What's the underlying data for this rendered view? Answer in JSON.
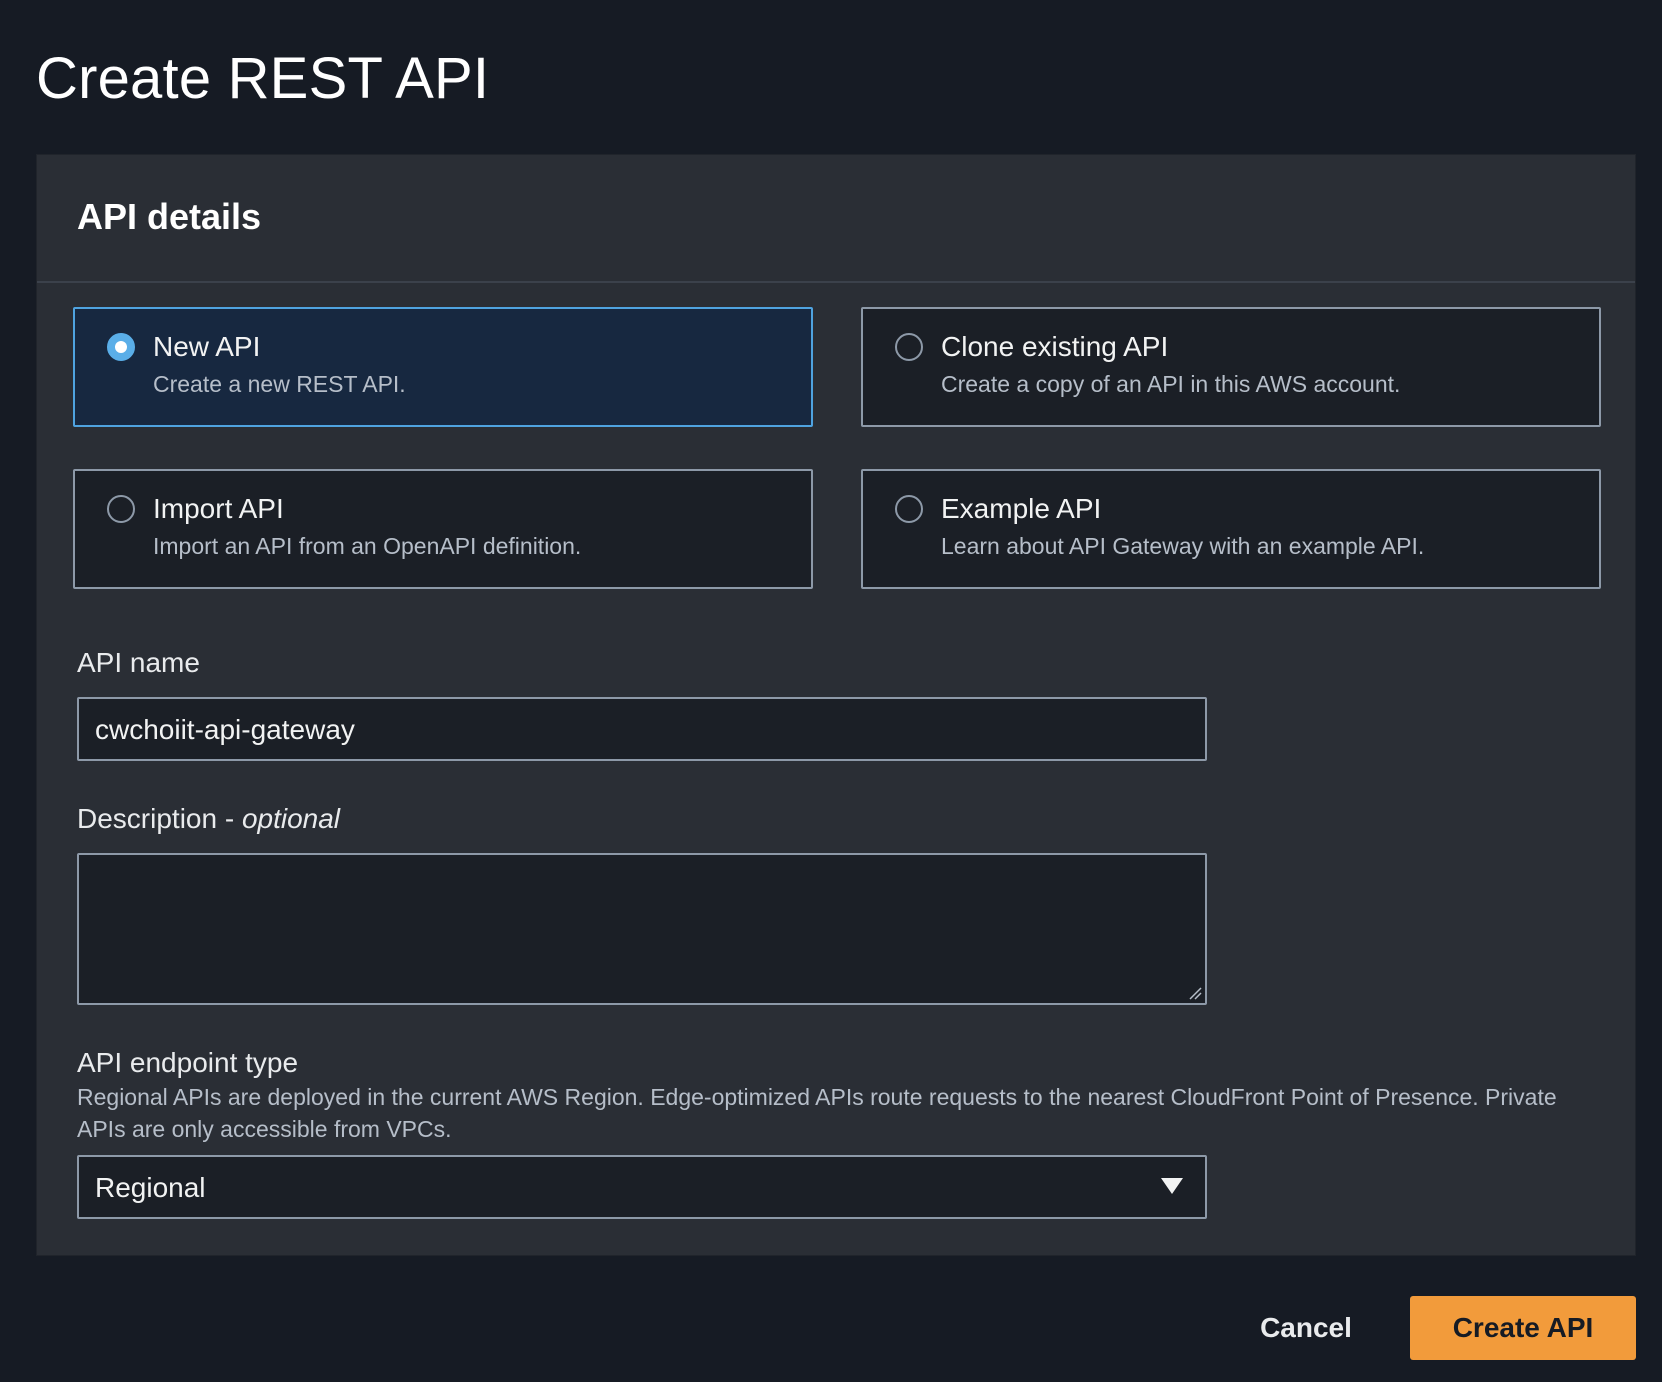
{
  "page": {
    "title": "Create REST API"
  },
  "panel": {
    "title": "API details"
  },
  "options": [
    {
      "title": "New API",
      "description": "Create a new REST API.",
      "selected": true
    },
    {
      "title": "Clone existing API",
      "description": "Create a copy of an API in this AWS account.",
      "selected": false
    },
    {
      "title": "Import API",
      "description": "Import an API from an OpenAPI definition.",
      "selected": false
    },
    {
      "title": "Example API",
      "description": "Learn about API Gateway with an example API.",
      "selected": false
    }
  ],
  "api_name": {
    "label": "API name",
    "value": "cwchoiit-api-gateway"
  },
  "description": {
    "label": "Description - ",
    "label_optional": "optional",
    "value": ""
  },
  "endpoint_type": {
    "label": "API endpoint type",
    "help": "Regional APIs are deployed in the current AWS Region. Edge-optimized APIs route requests to the nearest CloudFront Point of Presence. Private APIs are only accessible from VPCs.",
    "selected": "Regional"
  },
  "actions": {
    "cancel_label": "Cancel",
    "create_label": "Create API"
  },
  "colors": {
    "background": "#161b24",
    "panel": "#2a2e35",
    "accent_primary": "#f29b3b",
    "selected_border": "#4fa3e0"
  }
}
